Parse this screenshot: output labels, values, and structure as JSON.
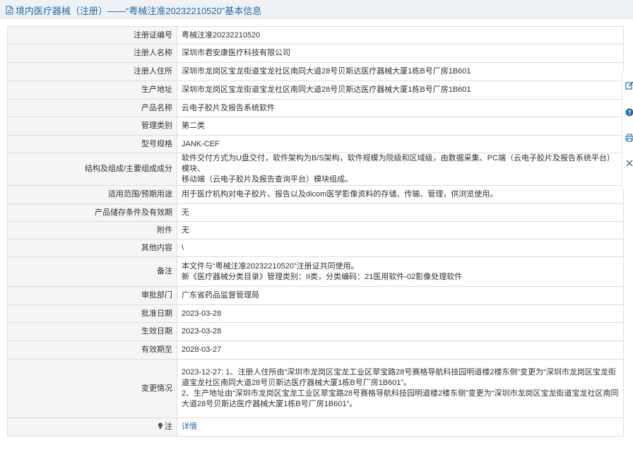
{
  "header": {
    "title": "境内医疗器械（注册）——“粤械注准20232210520”基本信息",
    "icon": "document-icon"
  },
  "rows": [
    {
      "label": "注册证编号",
      "value": "粤械注准20232210520"
    },
    {
      "label": "注册人名称",
      "value": "深圳市君安康医疗科技有限公司"
    },
    {
      "label": "注册人住所",
      "value": "深圳市龙岗区宝龙街道宝龙社区南同大道28号贝斯达医疗器械大厦1栋B号厂房1B601"
    },
    {
      "label": "生产地址",
      "value": "深圳市龙岗区宝龙街道宝龙社区南同大道28号贝斯达医疗器械大厦1栋B号厂房1B601"
    },
    {
      "label": "产品名称",
      "value": "云电子胶片及报告系统软件"
    },
    {
      "label": "管理类别",
      "value": "第二类"
    },
    {
      "label": "型号规格",
      "value": "JANK-CEF"
    },
    {
      "label": "结构及组成/主要组成成分",
      "lines": [
        "软件交付方式为U盘交付，软件架构为B/S架构，软件规模为院级和区域级，由数据采集、PC端（云电子胶片及报告系统平台）模块、",
        "移动端（云电子胶片及报告查询平台）模块组成。"
      ]
    },
    {
      "label": "适用范围/预期用途",
      "value": "用于医疗机构对电子胶片、报告以及dicom医学影像资料的存储、传输、管理，供浏览使用。"
    },
    {
      "label": "产品储存条件及有效期",
      "value": "无"
    },
    {
      "label": "附件",
      "value": "无"
    },
    {
      "label": "其他内容",
      "value": "\\"
    },
    {
      "label": "备注",
      "lines": [
        "本文件与“粤械注准20232210520”注册证共同使用。",
        "新《医疗器械分类目录》管理类别：II类，分类编码：21医用软件-02影像处理软件"
      ]
    },
    {
      "label": "审批部门",
      "value": "广东省药品监督管理局"
    },
    {
      "label": "批准日期",
      "value": "2023-03-28"
    },
    {
      "label": "生效日期",
      "value": "2023-03-28"
    },
    {
      "label": "有效期至",
      "value": "2028-03-27"
    },
    {
      "label": "变更情况",
      "lines": [
        "2023-12-27: 1、注册人住所由“深圳市龙岗区宝龙工业区翠宝路28号赛格导航科技园明道楼2楼东侧”变更为“深圳市龙岗区宝龙街",
        "道宝龙社区南同大道28号贝斯达医疗器械大厦1栋B号厂房1B601”。",
        "2、生产地址由“深圳市龙岗区宝龙工业区翠宝路28号赛格导航科技园明道楼2楼东侧”变更为“深圳市龙岗区宝龙街道宝龙社区南同",
        "大道28号贝斯达医疗器械大厦1栋B号厂房1B601”。"
      ]
    }
  ],
  "note_row": {
    "label_icon": "lightbulb-icon",
    "label": "注",
    "value": "详情"
  },
  "side_tools": [
    "edit-icon",
    "help-icon",
    "print-icon",
    "close-icon"
  ],
  "colors": {
    "link": "#2a6aa8",
    "label_bg": "#f5f5f5",
    "border": "#dddddd",
    "header_bg": "#eef2f6"
  }
}
